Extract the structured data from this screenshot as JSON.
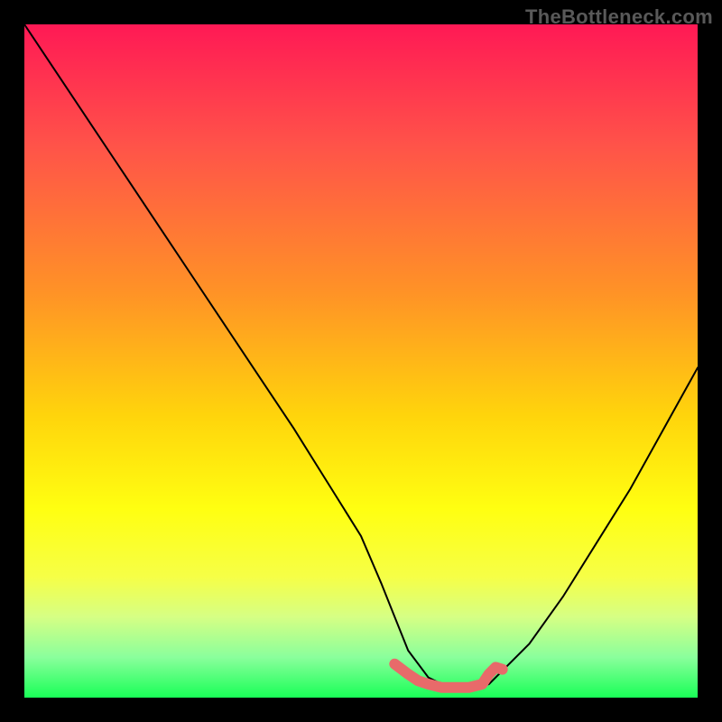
{
  "watermark": "TheBottleneck.com",
  "chart_data": {
    "type": "line",
    "title": "",
    "xlabel": "",
    "ylabel": "",
    "xlim": [
      0,
      100
    ],
    "ylim": [
      0,
      100
    ],
    "x": [
      0,
      5,
      10,
      15,
      20,
      25,
      30,
      35,
      40,
      45,
      50,
      53,
      55,
      57,
      60,
      62,
      64,
      67,
      69,
      71,
      75,
      80,
      85,
      90,
      95,
      100
    ],
    "values": [
      100,
      92.5,
      85,
      77.5,
      70,
      62.5,
      55,
      47.5,
      40,
      32,
      24,
      17,
      12,
      7,
      3,
      2,
      1.5,
      1.5,
      2,
      4,
      8,
      15,
      23,
      31,
      40,
      49
    ],
    "series": [
      {
        "name": "curve",
        "x": [
          0,
          5,
          10,
          15,
          20,
          25,
          30,
          35,
          40,
          45,
          50,
          53,
          55,
          57,
          60,
          62,
          64,
          67,
          69,
          71,
          75,
          80,
          85,
          90,
          95,
          100
        ],
        "y": [
          100,
          92.5,
          85,
          77.5,
          70,
          62.5,
          55,
          47.5,
          40,
          32,
          24,
          17,
          12,
          7,
          3,
          2,
          1.5,
          1.5,
          2,
          4,
          8,
          15,
          23,
          31,
          40,
          49
        ]
      },
      {
        "name": "low-highlight",
        "x": [
          55,
          57,
          58.5,
          60,
          62,
          64,
          66,
          68,
          69,
          70,
          71
        ],
        "y": [
          5,
          3.5,
          2.5,
          2,
          1.5,
          1.5,
          1.5,
          2,
          3.5,
          4.5,
          4.2
        ]
      }
    ],
    "highlight_color": "#e86a6a",
    "background_gradient": [
      "#ff1955",
      "#ff5349",
      "#ff9326",
      "#ffd40c",
      "#ffff11",
      "#f6ff46",
      "#d6ff84",
      "#8aff9c",
      "#19ff57"
    ]
  }
}
